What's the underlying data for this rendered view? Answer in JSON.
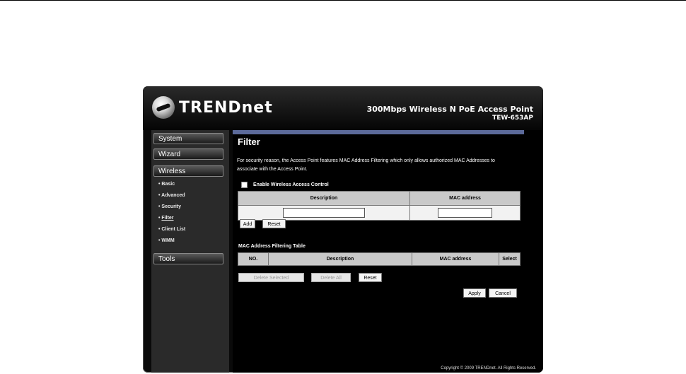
{
  "header": {
    "brand": "TRENDnet",
    "product_name": "300Mbps Wireless N PoE Access Point",
    "model": "TEW-653AP"
  },
  "sidebar": {
    "menus": [
      {
        "label": "System"
      },
      {
        "label": "Wizard"
      },
      {
        "label": "Wireless"
      },
      {
        "label": "Tools"
      }
    ],
    "wireless_items": [
      {
        "label": "Basic"
      },
      {
        "label": "Advanced"
      },
      {
        "label": "Security"
      },
      {
        "label": "Filter"
      },
      {
        "label": "Client List"
      },
      {
        "label": "WMM"
      }
    ]
  },
  "main": {
    "title": "Filter",
    "description": "For security reason, the Access Point features MAC Address Filtering which only allows authorized MAC Addresses to associate with the Access Point.",
    "enable_label": "Enable Wireless Access Control",
    "add_table": {
      "headers": [
        "Description",
        "MAC address"
      ],
      "description_value": "",
      "mac_value": ""
    },
    "add_button": "Add",
    "reset_button": "Reset",
    "filter_table_title": "MAC Address Filtering Table",
    "filter_table_headers": [
      "NO.",
      "Description",
      "MAC address",
      "Select"
    ],
    "delete_selected": "Delete Selected",
    "delete_all": "Delete All",
    "reset2": "Reset",
    "apply": "Apply",
    "cancel": "Cancel"
  },
  "footer": {
    "copyright": "Copyright © 2009 TRENDnet. All Rights Reserved."
  }
}
